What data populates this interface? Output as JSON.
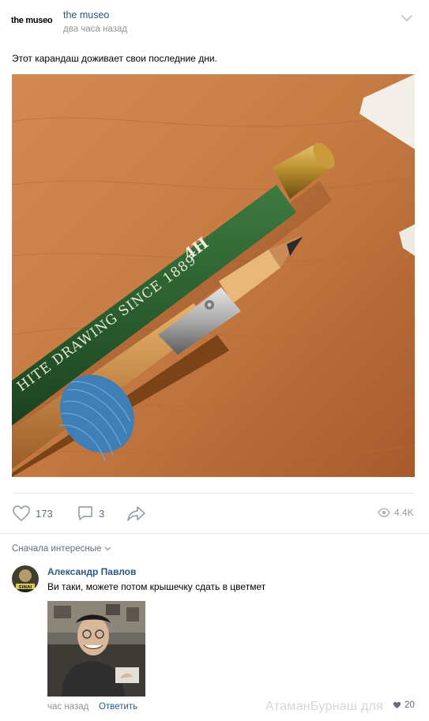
{
  "post": {
    "community_avatar_text": "the museo",
    "author": "the museo",
    "time": "два часа назад",
    "text": "Этот карандаш доживает свои последние дни.",
    "photo": {
      "pencil_print": "HITE DRAWING  SINCE 1889",
      "pencil_grade": "4H"
    },
    "actions": {
      "likes": "173",
      "comments": "3",
      "views": "4.4K"
    }
  },
  "comments_section": {
    "sort_label": "Сначала интересные"
  },
  "comment": {
    "author": "Александр Павлов",
    "text": "Ви таки, можете потом крышечку сдать в цветмет",
    "avatar_badge": "SINAI",
    "time": "час назад",
    "reply_label": "Ответить",
    "likes": "20"
  },
  "watermark": "АтаманБурнаш для",
  "icons": [
    "heart-icon",
    "comment-icon",
    "share-icon",
    "eye-icon",
    "chevron-down-icon"
  ],
  "colors": {
    "link": "#2a5885",
    "muted": "#939393",
    "action": "#626d7a",
    "divider": "#e7e8ec"
  }
}
